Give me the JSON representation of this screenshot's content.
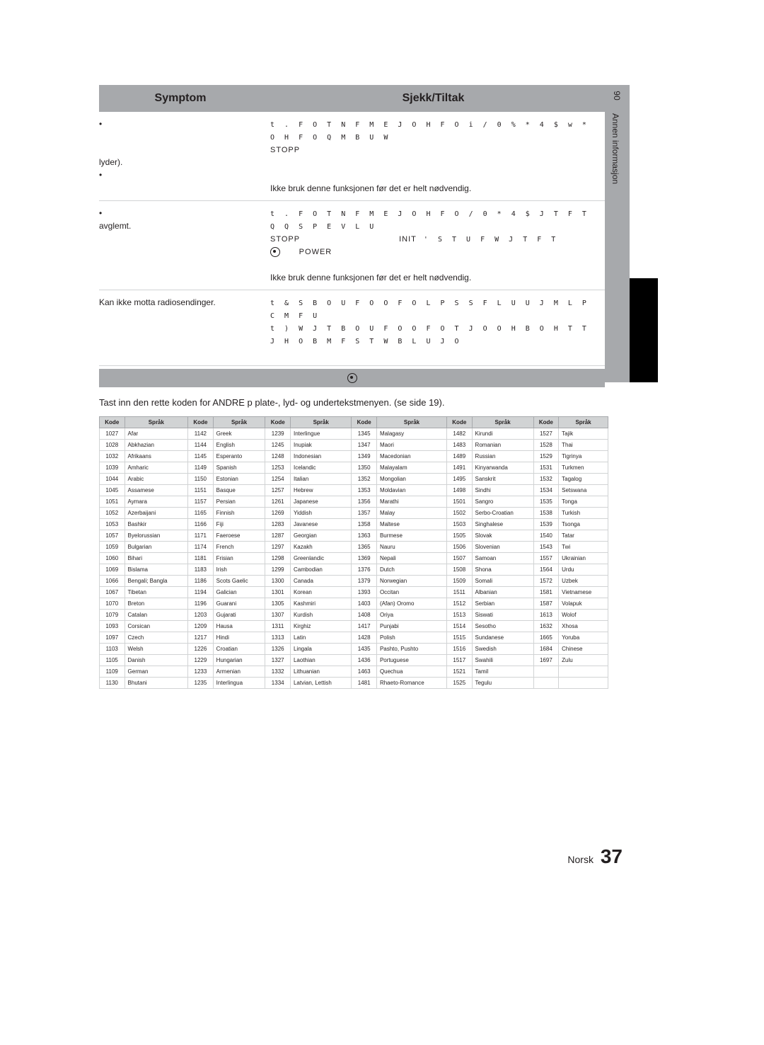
{
  "sidebar": {
    "section_no": "06",
    "section_label": "Annen informasjon"
  },
  "table": {
    "hdr_symptom": "Symptom",
    "hdr_action": "Sjekk/Tiltak",
    "rows": [
      {
        "symptom_bullet": "•",
        "symptom_suffix": "lyder).",
        "garbled1": "t . F O T  N F M E J O H F O  i / 0   % * 4 $ w    * O H F O   Q M B U   W",
        "stop1": "STOPP",
        "garbled2": "",
        "warn": "Ikke bruk denne funksjonen før det er helt nødvendig.",
        "bullet2": "•"
      },
      {
        "symptom_bullet": "•",
        "symptom_suffix": "avglemt.",
        "garbled1": "t . F O T  N F M E J O H F O   / 0   * 4 $    J T F T   Q    Q S P E V L U",
        "stop": "STOPP",
        "init": "INIT",
        "garbled2": "'   S T U F    W J T F T",
        "power": "POWER",
        "warn": "Ikke bruk denne funksjonen før det er helt nødvendig."
      },
      {
        "symptom": "Kan ikke motta radiosendinger.",
        "g1": "t  & S   B O U F O O F O   L P S S F L U   U J M L P C M F U",
        "g2": "t ) W J T   B O U F O O F O T   J O O H B O H T T J H O B M   F S   T W B L U    J O"
      }
    ]
  },
  "note_icon": "✎",
  "intro": "Tast inn den rette koden for ANDRE p  plate-, lyd- og undertekstmenyen. (se side 19).",
  "lang_hdr_code": "Kode",
  "lang_hdr_lang": "Språk",
  "languages": [
    [
      [
        "1027",
        "Afar"
      ],
      [
        "1142",
        "Greek"
      ],
      [
        "1239",
        "Interlingue"
      ],
      [
        "1345",
        "Malagasy"
      ],
      [
        "1482",
        "Kirundi"
      ],
      [
        "1527",
        "Tajik"
      ]
    ],
    [
      [
        "1028",
        "Abkhazian"
      ],
      [
        "1144",
        "English"
      ],
      [
        "1245",
        "Inupiak"
      ],
      [
        "1347",
        "Maori"
      ],
      [
        "1483",
        "Romanian"
      ],
      [
        "1528",
        "Thai"
      ]
    ],
    [
      [
        "1032",
        "Afrikaans"
      ],
      [
        "1145",
        "Esperanto"
      ],
      [
        "1248",
        "Indonesian"
      ],
      [
        "1349",
        "Macedonian"
      ],
      [
        "1489",
        "Russian"
      ],
      [
        "1529",
        "Tigrinya"
      ]
    ],
    [
      [
        "1039",
        "Amharic"
      ],
      [
        "1149",
        "Spanish"
      ],
      [
        "1253",
        "Icelandic"
      ],
      [
        "1350",
        "Malayalam"
      ],
      [
        "1491",
        "Kinyarwanda"
      ],
      [
        "1531",
        "Turkmen"
      ]
    ],
    [
      [
        "1044",
        "Arabic"
      ],
      [
        "1150",
        "Estonian"
      ],
      [
        "1254",
        "Italian"
      ],
      [
        "1352",
        "Mongolian"
      ],
      [
        "1495",
        "Sanskrit"
      ],
      [
        "1532",
        "Tagalog"
      ]
    ],
    [
      [
        "1045",
        "Assamese"
      ],
      [
        "1151",
        "Basque"
      ],
      [
        "1257",
        "Hebrew"
      ],
      [
        "1353",
        "Moldavian"
      ],
      [
        "1498",
        "Sindhi"
      ],
      [
        "1534",
        "Setswana"
      ]
    ],
    [
      [
        "1051",
        "Aymara"
      ],
      [
        "1157",
        "Persian"
      ],
      [
        "1261",
        "Japanese"
      ],
      [
        "1356",
        "Marathi"
      ],
      [
        "1501",
        "Sangro"
      ],
      [
        "1535",
        "Tonga"
      ]
    ],
    [
      [
        "1052",
        "Azerbaijani"
      ],
      [
        "1165",
        "Finnish"
      ],
      [
        "1269",
        "Yiddish"
      ],
      [
        "1357",
        "Malay"
      ],
      [
        "1502",
        "Serbo-Croatian"
      ],
      [
        "1538",
        "Turkish"
      ]
    ],
    [
      [
        "1053",
        "Bashkir"
      ],
      [
        "1166",
        "Fiji"
      ],
      [
        "1283",
        "Javanese"
      ],
      [
        "1358",
        "Maltese"
      ],
      [
        "1503",
        "Singhalese"
      ],
      [
        "1539",
        "Tsonga"
      ]
    ],
    [
      [
        "1057",
        "Byelorussian"
      ],
      [
        "1171",
        "Faeroese"
      ],
      [
        "1287",
        "Georgian"
      ],
      [
        "1363",
        "Burmese"
      ],
      [
        "1505",
        "Slovak"
      ],
      [
        "1540",
        "Tatar"
      ]
    ],
    [
      [
        "1059",
        "Bulgarian"
      ],
      [
        "1174",
        "French"
      ],
      [
        "1297",
        "Kazakh"
      ],
      [
        "1365",
        "Nauru"
      ],
      [
        "1506",
        "Slovenian"
      ],
      [
        "1543",
        "Twi"
      ]
    ],
    [
      [
        "1060",
        "Bihari"
      ],
      [
        "1181",
        "Frisian"
      ],
      [
        "1298",
        "Greenlandic"
      ],
      [
        "1369",
        "Nepali"
      ],
      [
        "1507",
        "Samoan"
      ],
      [
        "1557",
        "Ukrainian"
      ]
    ],
    [
      [
        "1069",
        "Bislama"
      ],
      [
        "1183",
        "Irish"
      ],
      [
        "1299",
        "Cambodian"
      ],
      [
        "1376",
        "Dutch"
      ],
      [
        "1508",
        "Shona"
      ],
      [
        "1564",
        "Urdu"
      ]
    ],
    [
      [
        "1066",
        "Bengali; Bangla"
      ],
      [
        "1186",
        "Scots Gaelic"
      ],
      [
        "1300",
        "Canada"
      ],
      [
        "1379",
        "Norwegian"
      ],
      [
        "1509",
        "Somali"
      ],
      [
        "1572",
        "Uzbek"
      ]
    ],
    [
      [
        "1067",
        "Tibetan"
      ],
      [
        "1194",
        "Galician"
      ],
      [
        "1301",
        "Korean"
      ],
      [
        "1393",
        "Occitan"
      ],
      [
        "1511",
        "Albanian"
      ],
      [
        "1581",
        "Vietnamese"
      ]
    ],
    [
      [
        "1070",
        "Breton"
      ],
      [
        "1196",
        "Guarani"
      ],
      [
        "1305",
        "Kashmiri"
      ],
      [
        "1403",
        "(Afan) Oromo"
      ],
      [
        "1512",
        "Serbian"
      ],
      [
        "1587",
        "Volapuk"
      ]
    ],
    [
      [
        "1079",
        "Catalan"
      ],
      [
        "1203",
        "Gujarati"
      ],
      [
        "1307",
        "Kurdish"
      ],
      [
        "1408",
        "Oriya"
      ],
      [
        "1513",
        "Siswati"
      ],
      [
        "1613",
        "Wolof"
      ]
    ],
    [
      [
        "1093",
        "Corsican"
      ],
      [
        "1209",
        "Hausa"
      ],
      [
        "1311",
        "Kirghiz"
      ],
      [
        "1417",
        "Punjabi"
      ],
      [
        "1514",
        "Sesotho"
      ],
      [
        "1632",
        "Xhosa"
      ]
    ],
    [
      [
        "1097",
        "Czech"
      ],
      [
        "1217",
        "Hindi"
      ],
      [
        "1313",
        "Latin"
      ],
      [
        "1428",
        "Polish"
      ],
      [
        "1515",
        "Sundanese"
      ],
      [
        "1665",
        "Yoruba"
      ]
    ],
    [
      [
        "1103",
        "Welsh"
      ],
      [
        "1226",
        "Croatian"
      ],
      [
        "1326",
        "Lingala"
      ],
      [
        "1435",
        "Pashto, Pushto"
      ],
      [
        "1516",
        "Swedish"
      ],
      [
        "1684",
        "Chinese"
      ]
    ],
    [
      [
        "1105",
        "Danish"
      ],
      [
        "1229",
        "Hungarian"
      ],
      [
        "1327",
        "Laothian"
      ],
      [
        "1436",
        "Portuguese"
      ],
      [
        "1517",
        "Swahili"
      ],
      [
        "1697",
        "Zulu"
      ]
    ],
    [
      [
        "1109",
        "German"
      ],
      [
        "1233",
        "Armenian"
      ],
      [
        "1332",
        "Lithuanian"
      ],
      [
        "1463",
        "Quechua"
      ],
      [
        "1521",
        "Tamil"
      ],
      [
        "",
        ""
      ]
    ],
    [
      [
        "1130",
        "Bhutani"
      ],
      [
        "1235",
        "Interlingua"
      ],
      [
        "1334",
        "Latvian, Lettish"
      ],
      [
        "1481",
        "Rhaeto-Romance"
      ],
      [
        "1525",
        "Tegulu"
      ],
      [
        "",
        ""
      ]
    ]
  ],
  "footer": {
    "lang": "Norsk",
    "page": "37"
  }
}
